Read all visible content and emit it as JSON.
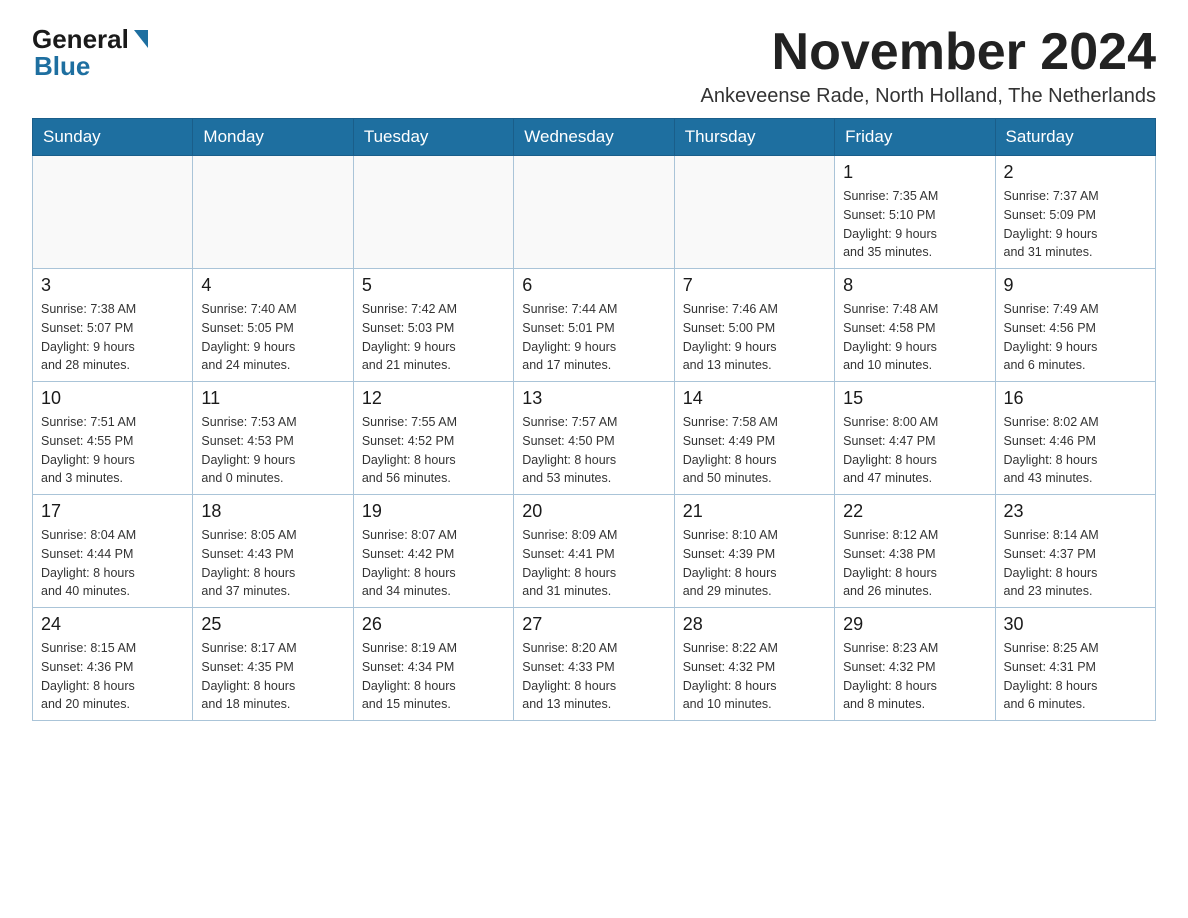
{
  "logo": {
    "general": "General",
    "blue": "Blue",
    "arrow_color": "#1e6fa0"
  },
  "header": {
    "title": "November 2024",
    "location": "Ankeveense Rade, North Holland, The Netherlands"
  },
  "days_of_week": [
    "Sunday",
    "Monday",
    "Tuesday",
    "Wednesday",
    "Thursday",
    "Friday",
    "Saturday"
  ],
  "weeks": [
    [
      {
        "day": "",
        "info": ""
      },
      {
        "day": "",
        "info": ""
      },
      {
        "day": "",
        "info": ""
      },
      {
        "day": "",
        "info": ""
      },
      {
        "day": "",
        "info": ""
      },
      {
        "day": "1",
        "info": "Sunrise: 7:35 AM\nSunset: 5:10 PM\nDaylight: 9 hours\nand 35 minutes."
      },
      {
        "day": "2",
        "info": "Sunrise: 7:37 AM\nSunset: 5:09 PM\nDaylight: 9 hours\nand 31 minutes."
      }
    ],
    [
      {
        "day": "3",
        "info": "Sunrise: 7:38 AM\nSunset: 5:07 PM\nDaylight: 9 hours\nand 28 minutes."
      },
      {
        "day": "4",
        "info": "Sunrise: 7:40 AM\nSunset: 5:05 PM\nDaylight: 9 hours\nand 24 minutes."
      },
      {
        "day": "5",
        "info": "Sunrise: 7:42 AM\nSunset: 5:03 PM\nDaylight: 9 hours\nand 21 minutes."
      },
      {
        "day": "6",
        "info": "Sunrise: 7:44 AM\nSunset: 5:01 PM\nDaylight: 9 hours\nand 17 minutes."
      },
      {
        "day": "7",
        "info": "Sunrise: 7:46 AM\nSunset: 5:00 PM\nDaylight: 9 hours\nand 13 minutes."
      },
      {
        "day": "8",
        "info": "Sunrise: 7:48 AM\nSunset: 4:58 PM\nDaylight: 9 hours\nand 10 minutes."
      },
      {
        "day": "9",
        "info": "Sunrise: 7:49 AM\nSunset: 4:56 PM\nDaylight: 9 hours\nand 6 minutes."
      }
    ],
    [
      {
        "day": "10",
        "info": "Sunrise: 7:51 AM\nSunset: 4:55 PM\nDaylight: 9 hours\nand 3 minutes."
      },
      {
        "day": "11",
        "info": "Sunrise: 7:53 AM\nSunset: 4:53 PM\nDaylight: 9 hours\nand 0 minutes."
      },
      {
        "day": "12",
        "info": "Sunrise: 7:55 AM\nSunset: 4:52 PM\nDaylight: 8 hours\nand 56 minutes."
      },
      {
        "day": "13",
        "info": "Sunrise: 7:57 AM\nSunset: 4:50 PM\nDaylight: 8 hours\nand 53 minutes."
      },
      {
        "day": "14",
        "info": "Sunrise: 7:58 AM\nSunset: 4:49 PM\nDaylight: 8 hours\nand 50 minutes."
      },
      {
        "day": "15",
        "info": "Sunrise: 8:00 AM\nSunset: 4:47 PM\nDaylight: 8 hours\nand 47 minutes."
      },
      {
        "day": "16",
        "info": "Sunrise: 8:02 AM\nSunset: 4:46 PM\nDaylight: 8 hours\nand 43 minutes."
      }
    ],
    [
      {
        "day": "17",
        "info": "Sunrise: 8:04 AM\nSunset: 4:44 PM\nDaylight: 8 hours\nand 40 minutes."
      },
      {
        "day": "18",
        "info": "Sunrise: 8:05 AM\nSunset: 4:43 PM\nDaylight: 8 hours\nand 37 minutes."
      },
      {
        "day": "19",
        "info": "Sunrise: 8:07 AM\nSunset: 4:42 PM\nDaylight: 8 hours\nand 34 minutes."
      },
      {
        "day": "20",
        "info": "Sunrise: 8:09 AM\nSunset: 4:41 PM\nDaylight: 8 hours\nand 31 minutes."
      },
      {
        "day": "21",
        "info": "Sunrise: 8:10 AM\nSunset: 4:39 PM\nDaylight: 8 hours\nand 29 minutes."
      },
      {
        "day": "22",
        "info": "Sunrise: 8:12 AM\nSunset: 4:38 PM\nDaylight: 8 hours\nand 26 minutes."
      },
      {
        "day": "23",
        "info": "Sunrise: 8:14 AM\nSunset: 4:37 PM\nDaylight: 8 hours\nand 23 minutes."
      }
    ],
    [
      {
        "day": "24",
        "info": "Sunrise: 8:15 AM\nSunset: 4:36 PM\nDaylight: 8 hours\nand 20 minutes."
      },
      {
        "day": "25",
        "info": "Sunrise: 8:17 AM\nSunset: 4:35 PM\nDaylight: 8 hours\nand 18 minutes."
      },
      {
        "day": "26",
        "info": "Sunrise: 8:19 AM\nSunset: 4:34 PM\nDaylight: 8 hours\nand 15 minutes."
      },
      {
        "day": "27",
        "info": "Sunrise: 8:20 AM\nSunset: 4:33 PM\nDaylight: 8 hours\nand 13 minutes."
      },
      {
        "day": "28",
        "info": "Sunrise: 8:22 AM\nSunset: 4:32 PM\nDaylight: 8 hours\nand 10 minutes."
      },
      {
        "day": "29",
        "info": "Sunrise: 8:23 AM\nSunset: 4:32 PM\nDaylight: 8 hours\nand 8 minutes."
      },
      {
        "day": "30",
        "info": "Sunrise: 8:25 AM\nSunset: 4:31 PM\nDaylight: 8 hours\nand 6 minutes."
      }
    ]
  ]
}
